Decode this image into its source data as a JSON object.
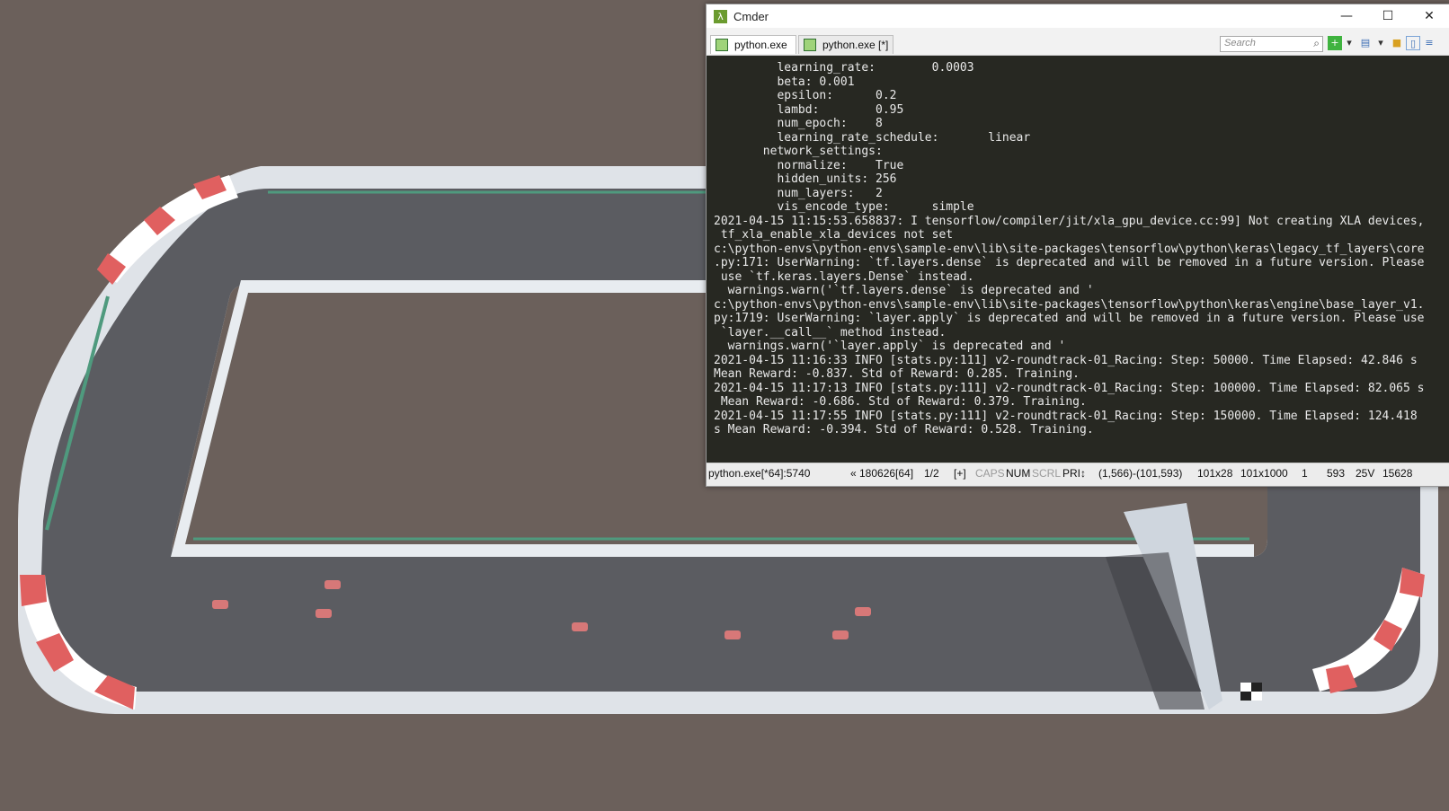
{
  "window": {
    "title": "Cmder",
    "tabs": [
      {
        "label": "python.exe"
      },
      {
        "label": "python.exe [*]"
      }
    ],
    "search_placeholder": "Search",
    "controls": {
      "minimize": "—",
      "maximize": "☐",
      "close": "✕"
    },
    "icons": {
      "app": "lambda-icon",
      "search": "magnifier-icon",
      "add": "plus-icon",
      "layout": "panel-icon",
      "lock": "lock-icon",
      "menu": "menu-icon"
    }
  },
  "console": {
    "lines": [
      "         learning_rate:        0.0003",
      "         beta: 0.001",
      "         epsilon:      0.2",
      "         lambd:        0.95",
      "         num_epoch:    8",
      "         learning_rate_schedule:       linear",
      "       network_settings:",
      "         normalize:    True",
      "         hidden_units: 256",
      "         num_layers:   2",
      "         vis_encode_type:      simple",
      "2021-04-15 11:15:53.658837: I tensorflow/compiler/jit/xla_gpu_device.cc:99] Not creating XLA devices,",
      " tf_xla_enable_xla_devices not set",
      "c:\\python-envs\\python-envs\\sample-env\\lib\\site-packages\\tensorflow\\python\\keras\\legacy_tf_layers\\core",
      ".py:171: UserWarning: `tf.layers.dense` is deprecated and will be removed in a future version. Please",
      " use `tf.keras.layers.Dense` instead.",
      "  warnings.warn('`tf.layers.dense` is deprecated and '",
      "c:\\python-envs\\python-envs\\sample-env\\lib\\site-packages\\tensorflow\\python\\keras\\engine\\base_layer_v1.",
      "py:1719: UserWarning: `layer.apply` is deprecated and will be removed in a future version. Please use",
      " `layer.__call__` method instead.",
      "  warnings.warn('`layer.apply` is deprecated and '",
      "2021-04-15 11:16:33 INFO [stats.py:111] v2-roundtrack-01_Racing: Step: 50000. Time Elapsed: 42.846 s",
      "Mean Reward: -0.837. Std of Reward: 0.285. Training.",
      "2021-04-15 11:17:13 INFO [stats.py:111] v2-roundtrack-01_Racing: Step: 100000. Time Elapsed: 82.065 s",
      " Mean Reward: -0.686. Std of Reward: 0.379. Training.",
      "2021-04-15 11:17:55 INFO [stats.py:111] v2-roundtrack-01_Racing: Step: 150000. Time Elapsed: 124.418",
      "s Mean Reward: -0.394. Std of Reward: 0.528. Training."
    ]
  },
  "statusbar": {
    "process": "python.exe[*64]:5740",
    "build": "« 180626[64]",
    "page": "1/2",
    "plus": "[+]",
    "caps": "CAPS",
    "num": "NUM",
    "scrl": "SCRL",
    "pri": "PRI↕",
    "selection": "(1,566)-(101,593)",
    "size": "101x28",
    "buffer": "101x1000",
    "one": "1",
    "pos": "593",
    "volts": "25V",
    "pid": "15628"
  },
  "scene": {
    "background": "#6b605b",
    "track_color": "#5b5c61",
    "curb_red": "#e06060",
    "wall": "#e8ecf0",
    "rail_green": "#4f9a7e",
    "car_color": "#d77878"
  }
}
